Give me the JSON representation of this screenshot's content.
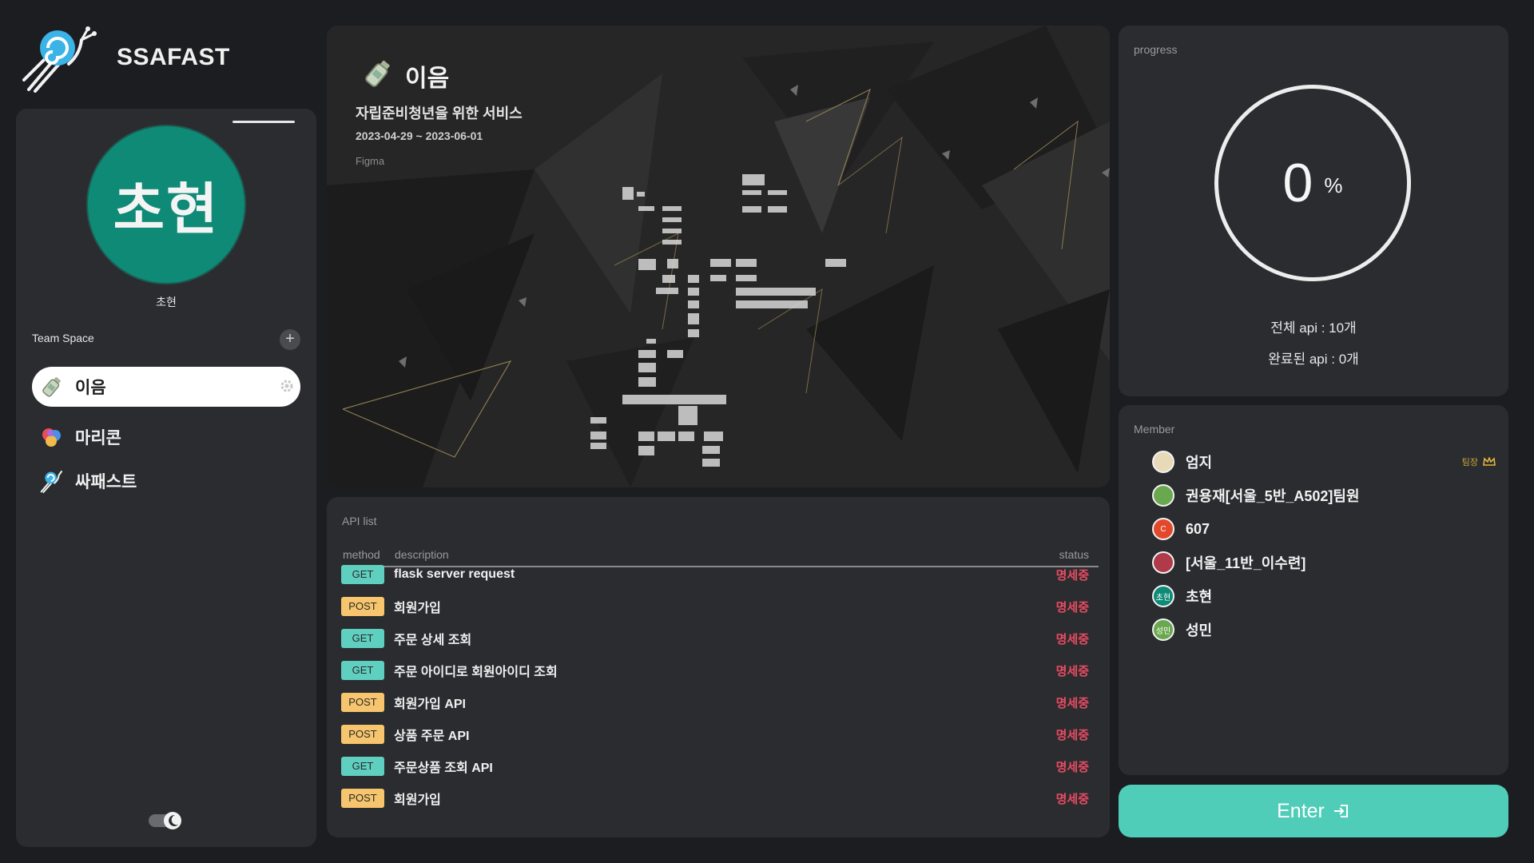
{
  "app": {
    "name": "SSAFAST"
  },
  "sidebar": {
    "profile": {
      "avatar_text": "초현",
      "name": "초현"
    },
    "team_space_label": "Team Space",
    "add_icon": "plus-icon",
    "teams": [
      {
        "name": "이음",
        "icon": "bottle-icon",
        "active": true
      },
      {
        "name": "마리콘",
        "icon": "marikon-logo-icon",
        "active": false
      },
      {
        "name": "싸패스트",
        "icon": "ssafast-logo-icon",
        "active": false
      }
    ],
    "theme_toggle_icon": "moon-icon"
  },
  "project": {
    "title": "이음",
    "description": "자립준비청년을 위한 서비스",
    "dates": "2023-04-29 ~ 2023-06-01",
    "tool": "Figma"
  },
  "api_list": {
    "title": "API list",
    "headers": {
      "method": "method",
      "description": "description",
      "status": "status"
    },
    "rows": [
      {
        "method": "GET",
        "description": "flask server request",
        "status": "명세중"
      },
      {
        "method": "POST",
        "description": "회원가입",
        "status": "명세중"
      },
      {
        "method": "GET",
        "description": "주문 상세 조회",
        "status": "명세중"
      },
      {
        "method": "GET",
        "description": "주문 아이디로 회원아이디 조회",
        "status": "명세중"
      },
      {
        "method": "POST",
        "description": "회원가입 API",
        "status": "명세중"
      },
      {
        "method": "POST",
        "description": "상품 주문 API",
        "status": "명세중"
      },
      {
        "method": "GET",
        "description": "주문상품 조회 API",
        "status": "명세중"
      },
      {
        "method": "POST",
        "description": "회원가입",
        "status": "명세중"
      }
    ]
  },
  "progress": {
    "title": "progress",
    "percent": "0",
    "percent_sign": "%",
    "total_api": "전체 api : 10개",
    "done_api": "완료된 api : 0개"
  },
  "members": {
    "title": "Member",
    "leader_label": "팀장",
    "list": [
      {
        "name": "엄지",
        "avatar_text": "",
        "color": "#e8d9b8",
        "leader": true
      },
      {
        "name": "권용재[서울_5반_A502]팀원",
        "avatar_text": "",
        "color": "#6aa84f",
        "leader": false
      },
      {
        "name": "607",
        "avatar_text": "C",
        "color": "#e2492b",
        "leader": false
      },
      {
        "name": "[서울_11반_이수련]",
        "avatar_text": "",
        "color": "#b03a4a",
        "leader": false
      },
      {
        "name": "초현",
        "avatar_text": "초현",
        "color": "#0e8a76",
        "leader": false
      },
      {
        "name": "성민",
        "avatar_text": "성민",
        "color": "#6aa84f",
        "leader": false
      }
    ]
  },
  "enter": {
    "label": "Enter",
    "icon": "enter-icon"
  },
  "colors": {
    "accent": "#4fcdb8",
    "get": "#5fcfbf",
    "post": "#f6c56d",
    "status": "#ea4b62",
    "panel": "#2b2c30"
  }
}
